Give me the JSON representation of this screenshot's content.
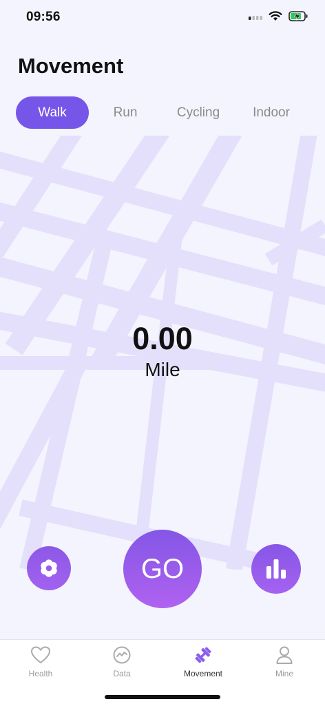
{
  "status_bar": {
    "time": "09:56",
    "icons": [
      "signal-icon",
      "wifi-icon",
      "battery-charging-icon"
    ],
    "battery_color": "#30c85a"
  },
  "page": {
    "title": "Movement"
  },
  "tabs": [
    {
      "label": "Walk",
      "active": true
    },
    {
      "label": "Run",
      "active": false
    },
    {
      "label": "Cycling",
      "active": false
    },
    {
      "label": "Indoor",
      "active": false
    }
  ],
  "distance": {
    "value": "0.00",
    "unit": "Mile"
  },
  "actions": {
    "settings_icon": "gear-icon",
    "go_label": "GO",
    "stats_icon": "bar-chart-icon"
  },
  "bottom_nav": [
    {
      "label": "Health",
      "icon": "heart-icon",
      "active": false
    },
    {
      "label": "Data",
      "icon": "activity-icon",
      "active": false
    },
    {
      "label": "Movement",
      "icon": "dumbbell-icon",
      "active": true
    },
    {
      "label": "Mine",
      "icon": "person-icon",
      "active": false
    }
  ],
  "colors": {
    "accent": "#7656e8",
    "go_gradient_start": "#8456e6",
    "go_gradient_end": "#b061ef",
    "background": "#f3f4fd",
    "map_road": "#e4e0fb"
  }
}
